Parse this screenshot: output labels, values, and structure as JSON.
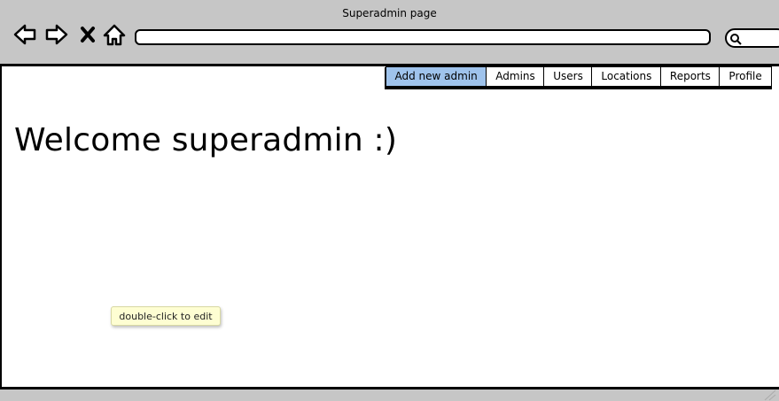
{
  "window": {
    "title": "Superadmin page"
  },
  "browser": {
    "icons": [
      "back-arrow-icon",
      "forward-arrow-icon",
      "close-x-icon",
      "home-icon",
      "search-icon"
    ],
    "address_value": "",
    "search_value": ""
  },
  "nav": {
    "tabs": [
      {
        "label": "Add new admin",
        "active": true
      },
      {
        "label": "Admins",
        "active": false
      },
      {
        "label": "Users",
        "active": false
      },
      {
        "label": "Locations",
        "active": false
      },
      {
        "label": "Reports",
        "active": false
      },
      {
        "label": "Profile",
        "active": false
      }
    ]
  },
  "main": {
    "heading": "Welcome superadmin :)"
  },
  "tooltip": {
    "text": "double-click to edit"
  },
  "colors": {
    "chrome": "#c6c6c6",
    "active_tab": "#9fc3ec",
    "tooltip_bg": "#fefed2"
  }
}
